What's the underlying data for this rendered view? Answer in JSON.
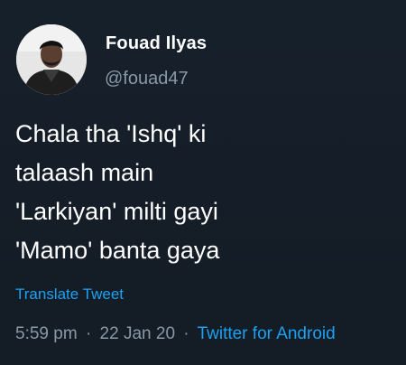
{
  "user": {
    "display_name": "Fouad Ilyas",
    "handle": "@fouad47"
  },
  "tweet": {
    "lines": [
      "Chala tha 'Ishq' ki",
      "talaash main",
      "'Larkiyan' milti gayi",
      "'Mamo' banta gaya"
    ],
    "translate_label": "Translate Tweet",
    "time": "5:59 pm",
    "date": "22 Jan 20",
    "separator": "·",
    "source": "Twitter for Android"
  },
  "colors": {
    "background": "#161e27",
    "accent": "#1da1f2",
    "secondary_text": "#8899a6"
  }
}
